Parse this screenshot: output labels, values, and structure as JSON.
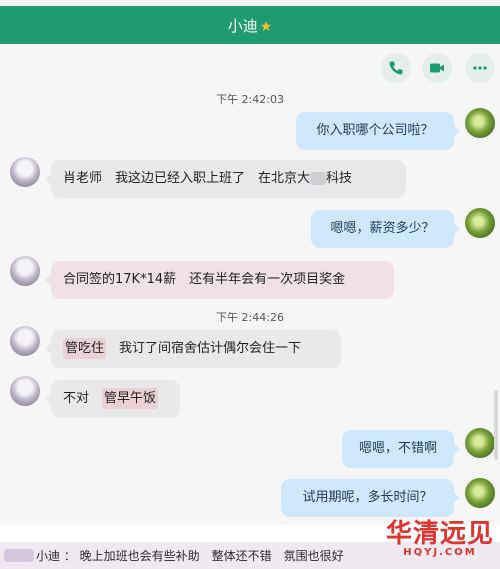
{
  "header": {
    "title": "小迪",
    "star": "★"
  },
  "toolbar": {
    "icons": [
      "phone-icon",
      "video-icon",
      "more-icon"
    ]
  },
  "messages": {
    "t1": "下午 2:42:03",
    "m1": "你入职哪个公司啦？",
    "m2a": "肖老师　我这边已经入职上班了　在北京大",
    "m2b": "科技",
    "m3": "嗯嗯，薪资多少？",
    "m4": "合同签的17K*14薪　还有半年会有一次项目奖金",
    "t2": "下午 2:44:26",
    "m5a": "管吃住",
    "m5b": "我订了间宿舍估计偶尔会住一下",
    "m6a": "不对",
    "m6b": "管早午饭",
    "m7": "嗯嗯，不错啊",
    "m8": "试用期呢，多长时间？"
  },
  "bottom_bar": {
    "text": "小迪 ：  晚上加班也会有些补助　整体还不错　氛围也很好"
  },
  "watermark": {
    "cn": "华清远见",
    "en": "HQYJ.COM"
  },
  "colors": {
    "header": "#1f9b72",
    "outgoing": "#cfe8fb",
    "incoming": "#e9e9ec",
    "highlight": "#ead1d6"
  }
}
